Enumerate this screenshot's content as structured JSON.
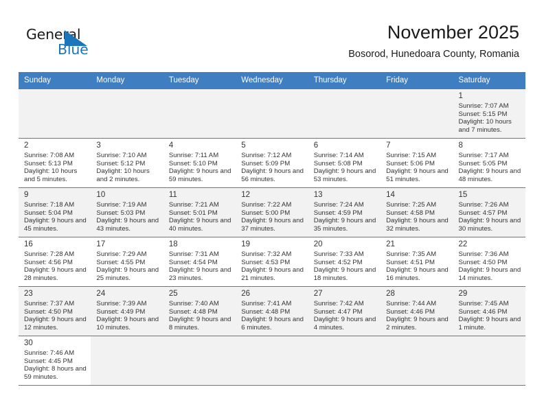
{
  "brand": {
    "name_top": "General",
    "name_bottom": "Blue",
    "accent_color": "#1b75bb",
    "flag_icon": "blue-triangle-flag-icon"
  },
  "header": {
    "title": "November 2025",
    "subtitle": "Bosorod, Hunedoara County, Romania"
  },
  "theme": {
    "header_row_color": "#3f7fc1",
    "shaded_cell_color": "#f2f2f2",
    "text_color": "#333333"
  },
  "calendar": {
    "weekday_headers": [
      "Sunday",
      "Monday",
      "Tuesday",
      "Wednesday",
      "Thursday",
      "Friday",
      "Saturday"
    ],
    "weeks": [
      [
        {
          "day": "",
          "sunrise": "",
          "sunset": "",
          "daylight": "",
          "empty": true
        },
        {
          "day": "",
          "sunrise": "",
          "sunset": "",
          "daylight": "",
          "empty": true
        },
        {
          "day": "",
          "sunrise": "",
          "sunset": "",
          "daylight": "",
          "empty": true
        },
        {
          "day": "",
          "sunrise": "",
          "sunset": "",
          "daylight": "",
          "empty": true
        },
        {
          "day": "",
          "sunrise": "",
          "sunset": "",
          "daylight": "",
          "empty": true
        },
        {
          "day": "",
          "sunrise": "",
          "sunset": "",
          "daylight": "",
          "empty": true
        },
        {
          "day": "1",
          "sunrise": "Sunrise: 7:07 AM",
          "sunset": "Sunset: 5:15 PM",
          "daylight": "Daylight: 10 hours and 7 minutes."
        }
      ],
      [
        {
          "day": "2",
          "sunrise": "Sunrise: 7:08 AM",
          "sunset": "Sunset: 5:13 PM",
          "daylight": "Daylight: 10 hours and 5 minutes."
        },
        {
          "day": "3",
          "sunrise": "Sunrise: 7:10 AM",
          "sunset": "Sunset: 5:12 PM",
          "daylight": "Daylight: 10 hours and 2 minutes."
        },
        {
          "day": "4",
          "sunrise": "Sunrise: 7:11 AM",
          "sunset": "Sunset: 5:10 PM",
          "daylight": "Daylight: 9 hours and 59 minutes."
        },
        {
          "day": "5",
          "sunrise": "Sunrise: 7:12 AM",
          "sunset": "Sunset: 5:09 PM",
          "daylight": "Daylight: 9 hours and 56 minutes."
        },
        {
          "day": "6",
          "sunrise": "Sunrise: 7:14 AM",
          "sunset": "Sunset: 5:08 PM",
          "daylight": "Daylight: 9 hours and 53 minutes."
        },
        {
          "day": "7",
          "sunrise": "Sunrise: 7:15 AM",
          "sunset": "Sunset: 5:06 PM",
          "daylight": "Daylight: 9 hours and 51 minutes."
        },
        {
          "day": "8",
          "sunrise": "Sunrise: 7:17 AM",
          "sunset": "Sunset: 5:05 PM",
          "daylight": "Daylight: 9 hours and 48 minutes."
        }
      ],
      [
        {
          "day": "9",
          "sunrise": "Sunrise: 7:18 AM",
          "sunset": "Sunset: 5:04 PM",
          "daylight": "Daylight: 9 hours and 45 minutes."
        },
        {
          "day": "10",
          "sunrise": "Sunrise: 7:19 AM",
          "sunset": "Sunset: 5:03 PM",
          "daylight": "Daylight: 9 hours and 43 minutes."
        },
        {
          "day": "11",
          "sunrise": "Sunrise: 7:21 AM",
          "sunset": "Sunset: 5:01 PM",
          "daylight": "Daylight: 9 hours and 40 minutes."
        },
        {
          "day": "12",
          "sunrise": "Sunrise: 7:22 AM",
          "sunset": "Sunset: 5:00 PM",
          "daylight": "Daylight: 9 hours and 37 minutes."
        },
        {
          "day": "13",
          "sunrise": "Sunrise: 7:24 AM",
          "sunset": "Sunset: 4:59 PM",
          "daylight": "Daylight: 9 hours and 35 minutes."
        },
        {
          "day": "14",
          "sunrise": "Sunrise: 7:25 AM",
          "sunset": "Sunset: 4:58 PM",
          "daylight": "Daylight: 9 hours and 32 minutes."
        },
        {
          "day": "15",
          "sunrise": "Sunrise: 7:26 AM",
          "sunset": "Sunset: 4:57 PM",
          "daylight": "Daylight: 9 hours and 30 minutes."
        }
      ],
      [
        {
          "day": "16",
          "sunrise": "Sunrise: 7:28 AM",
          "sunset": "Sunset: 4:56 PM",
          "daylight": "Daylight: 9 hours and 28 minutes."
        },
        {
          "day": "17",
          "sunrise": "Sunrise: 7:29 AM",
          "sunset": "Sunset: 4:55 PM",
          "daylight": "Daylight: 9 hours and 25 minutes."
        },
        {
          "day": "18",
          "sunrise": "Sunrise: 7:31 AM",
          "sunset": "Sunset: 4:54 PM",
          "daylight": "Daylight: 9 hours and 23 minutes."
        },
        {
          "day": "19",
          "sunrise": "Sunrise: 7:32 AM",
          "sunset": "Sunset: 4:53 PM",
          "daylight": "Daylight: 9 hours and 21 minutes."
        },
        {
          "day": "20",
          "sunrise": "Sunrise: 7:33 AM",
          "sunset": "Sunset: 4:52 PM",
          "daylight": "Daylight: 9 hours and 18 minutes."
        },
        {
          "day": "21",
          "sunrise": "Sunrise: 7:35 AM",
          "sunset": "Sunset: 4:51 PM",
          "daylight": "Daylight: 9 hours and 16 minutes."
        },
        {
          "day": "22",
          "sunrise": "Sunrise: 7:36 AM",
          "sunset": "Sunset: 4:50 PM",
          "daylight": "Daylight: 9 hours and 14 minutes."
        }
      ],
      [
        {
          "day": "23",
          "sunrise": "Sunrise: 7:37 AM",
          "sunset": "Sunset: 4:50 PM",
          "daylight": "Daylight: 9 hours and 12 minutes."
        },
        {
          "day": "24",
          "sunrise": "Sunrise: 7:39 AM",
          "sunset": "Sunset: 4:49 PM",
          "daylight": "Daylight: 9 hours and 10 minutes."
        },
        {
          "day": "25",
          "sunrise": "Sunrise: 7:40 AM",
          "sunset": "Sunset: 4:48 PM",
          "daylight": "Daylight: 9 hours and 8 minutes."
        },
        {
          "day": "26",
          "sunrise": "Sunrise: 7:41 AM",
          "sunset": "Sunset: 4:48 PM",
          "daylight": "Daylight: 9 hours and 6 minutes."
        },
        {
          "day": "27",
          "sunrise": "Sunrise: 7:42 AM",
          "sunset": "Sunset: 4:47 PM",
          "daylight": "Daylight: 9 hours and 4 minutes."
        },
        {
          "day": "28",
          "sunrise": "Sunrise: 7:44 AM",
          "sunset": "Sunset: 4:46 PM",
          "daylight": "Daylight: 9 hours and 2 minutes."
        },
        {
          "day": "29",
          "sunrise": "Sunrise: 7:45 AM",
          "sunset": "Sunset: 4:46 PM",
          "daylight": "Daylight: 9 hours and 1 minute."
        }
      ],
      [
        {
          "day": "30",
          "sunrise": "Sunrise: 7:46 AM",
          "sunset": "Sunset: 4:45 PM",
          "daylight": "Daylight: 8 hours and 59 minutes."
        },
        {
          "day": "",
          "sunrise": "",
          "sunset": "",
          "daylight": "",
          "empty": true
        },
        {
          "day": "",
          "sunrise": "",
          "sunset": "",
          "daylight": "",
          "empty": true
        },
        {
          "day": "",
          "sunrise": "",
          "sunset": "",
          "daylight": "",
          "empty": true
        },
        {
          "day": "",
          "sunrise": "",
          "sunset": "",
          "daylight": "",
          "empty": true
        },
        {
          "day": "",
          "sunrise": "",
          "sunset": "",
          "daylight": "",
          "empty": true
        },
        {
          "day": "",
          "sunrise": "",
          "sunset": "",
          "daylight": "",
          "empty": true
        }
      ]
    ]
  }
}
